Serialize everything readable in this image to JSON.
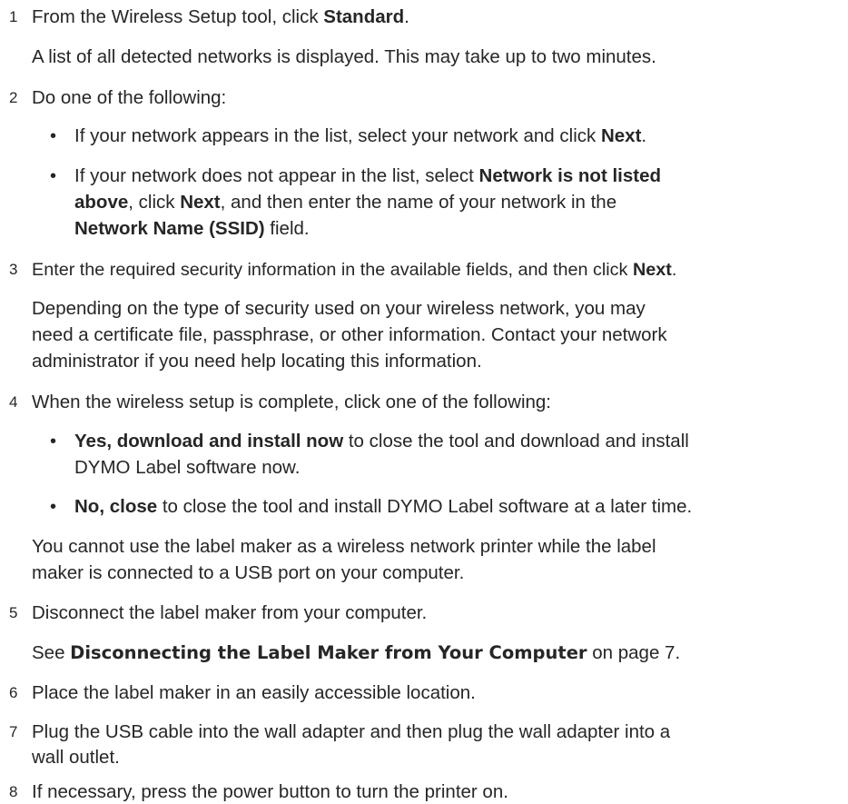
{
  "steps": [
    {
      "number": "1",
      "pre": "From the Wireless Setup tool, click ",
      "bold": "Standard",
      "post": ".",
      "note": "A list of all detected networks is displayed. This may take up to two minutes."
    },
    {
      "number": "2",
      "text": "Do one of the following:",
      "bullets": [
        {
          "marker": "•",
          "pre": "If your network appears in the list, select your network and click ",
          "bold": "Next",
          "post": "."
        },
        {
          "marker": "•",
          "l1_pre": "If your network does not appear in the list, select ",
          "l1_bold": "Network is not listed",
          "l2_bold": "above",
          "l2_mid": ", click ",
          "l2_bold2": "Next",
          "l2_post": ", and then enter the name of your network in the",
          "l3_bold": "Network Name (SSID)",
          "l3_post": " field."
        }
      ]
    },
    {
      "number": "3",
      "pre": "Enter the required security information in the available fields, and then click ",
      "bold": "Next",
      "post": ".",
      "note_lines": [
        "Depending on the type of security used on your wireless network, you may",
        "need a certificate file, passphrase, or other information. Contact your network",
        "administrator if you need help locating this information."
      ]
    },
    {
      "number": "4",
      "text": "When the wireless setup is complete, click one of the following:",
      "bullets": [
        {
          "marker": "•",
          "bold": "Yes, download and install now",
          "post": " to close the tool and download and install",
          "line2": "DYMO Label software now."
        },
        {
          "marker": "•",
          "bold": "No, close",
          "post": " to close the tool and install DYMO Label software at a later time."
        }
      ],
      "note_lines": [
        "You cannot use the label maker as a wireless network printer while the label",
        "maker is connected to a USB port on your computer."
      ]
    },
    {
      "number": "5",
      "text": "Disconnect the label maker from your computer.",
      "see_pre": "See ",
      "see_bold": "Disconnecting the Label Maker from Your Computer",
      "see_post": " on page 7."
    },
    {
      "number": "6",
      "text": "Place the label maker in an easily accessible location."
    },
    {
      "number": "7",
      "line1": "Plug the USB cable into the wall adapter and then plug the wall adapter into a",
      "line2": "wall outlet."
    },
    {
      "number": "8",
      "text": "If necessary, press the power button to turn the printer on."
    }
  ]
}
